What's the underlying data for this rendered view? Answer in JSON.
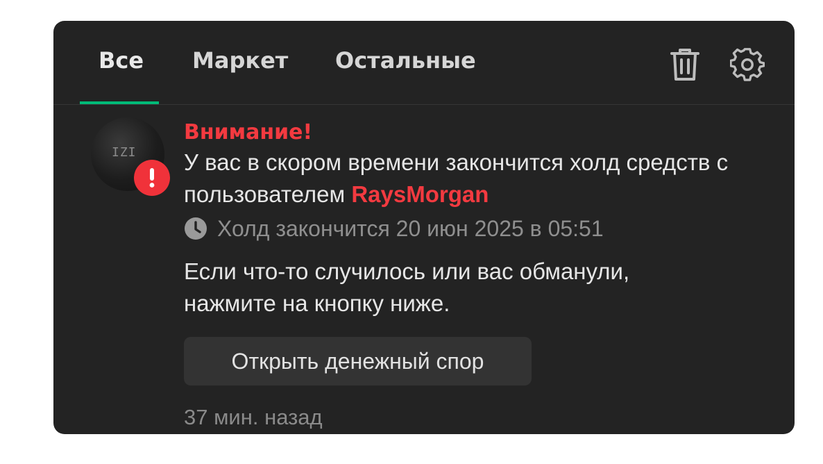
{
  "tabs": [
    {
      "label": "Все",
      "active": true
    },
    {
      "label": "Маркет",
      "active": false
    },
    {
      "label": "Остальные",
      "active": false
    }
  ],
  "toolbar": {
    "delete_icon": "trash-icon",
    "settings_icon": "gear-icon"
  },
  "notification": {
    "avatar_text": "IZI",
    "badge_icon": "exclamation-icon",
    "title": "Внимание!",
    "message_prefix": "У вас в скором времени закончится холд средств с пользователем",
    "username": "RaysMorgan",
    "hold_text": "Холд закончится 20 июн 2025 в 05:51",
    "note": "Если что-то случилось или вас обманули, нажмите на кнопку ниже.",
    "button_label": "Открыть денежный спор",
    "time_ago": "37 мин. назад"
  },
  "colors": {
    "panel_bg": "#232323",
    "accent_green": "#00ba78",
    "alert_red": "#f33a40",
    "button_bg": "#333333",
    "muted_text": "#8f8f8f"
  }
}
